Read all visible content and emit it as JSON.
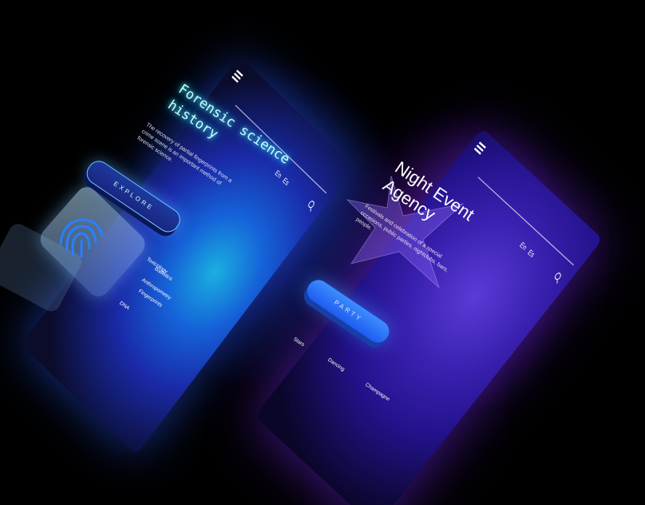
{
  "screen1": {
    "title_line1": "Forensic science",
    "title_line2": "history",
    "description": "The recovery of partial fingerprints from a crime scene is an important method of forensic science.",
    "button_label": "EXPLORE",
    "lang_en": "En",
    "lang_es": "Es",
    "nav": [
      "Toxicology",
      "Ballistics",
      "Anthropometry",
      "Fingerprints",
      "DNA"
    ]
  },
  "screen2": {
    "title_line1": "Night Event",
    "title_line2": "Agency",
    "description": "Festivals and celebration of a special occasions, public parties, nightclubs, bars, people.",
    "button_label": "PARTY",
    "lang_en": "En",
    "lang_es": "Es",
    "nav": [
      "Stars",
      "Dancing",
      "Champagne"
    ]
  },
  "colors": {
    "screen1_accent": "#1ab0e0",
    "screen2_accent": "#5b3bd6",
    "explore_glow": "#66ccff",
    "party_button": "#3d8dff"
  },
  "icons": [
    "menu-icon",
    "search-icon",
    "fingerprint-icon",
    "star-icon"
  ]
}
